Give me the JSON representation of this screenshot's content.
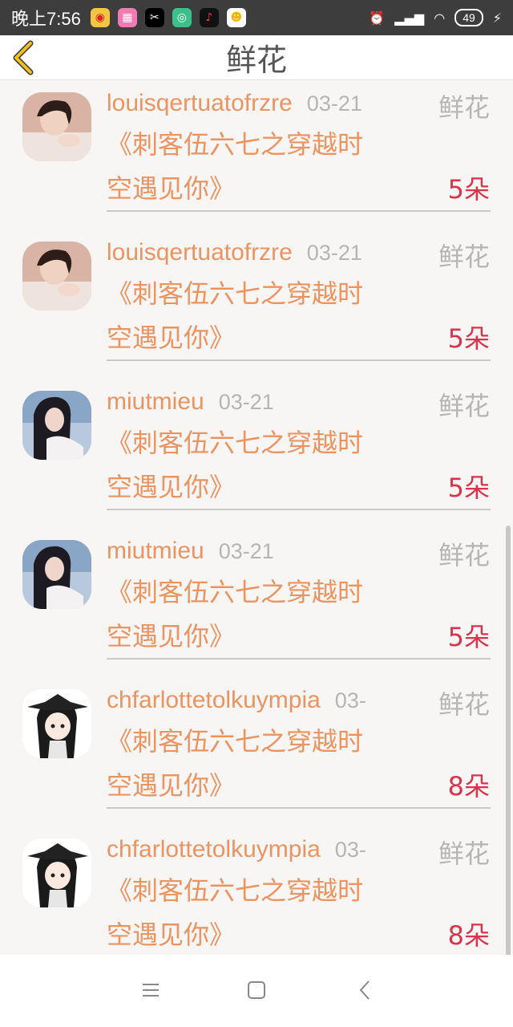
{
  "status": {
    "time": "晚上7:56",
    "battery": "49",
    "apps": [
      "weibo-icon",
      "game-icon",
      "capcut-icon",
      "signal-app-icon",
      "tiktok-icon",
      "chat-app-icon"
    ]
  },
  "header": {
    "title": "鲜花"
  },
  "items": [
    {
      "user": "louisqertuatofrzre",
      "date": "03-21",
      "gift": "鲜花",
      "work_line1": "《刺客伍六七之穿越时",
      "work_line2": "空遇见你》",
      "count": "5朵",
      "avatar": "girl-reading"
    },
    {
      "user": "louisqertuatofrzre",
      "date": "03-21",
      "gift": "鲜花",
      "work_line1": "《刺客伍六七之穿越时",
      "work_line2": "空遇见你》",
      "count": "5朵",
      "avatar": "girl-reading"
    },
    {
      "user": "miutmieu",
      "date": "03-21",
      "gift": "鲜花",
      "work_line1": "《刺客伍六七之穿越时",
      "work_line2": "空遇见你》",
      "count": "5朵",
      "avatar": "girl-sky"
    },
    {
      "user": "miutmieu",
      "date": "03-21",
      "gift": "鲜花",
      "work_line1": "《刺客伍六七之穿越时",
      "work_line2": "空遇见你》",
      "count": "5朵",
      "avatar": "girl-sky"
    },
    {
      "user": "chfarlottetolkuympia",
      "date": "03-",
      "gift": "鲜花",
      "work_line1": "《刺客伍六七之穿越时",
      "work_line2": "空遇见你》",
      "count": "8朵",
      "avatar": "cartoon"
    },
    {
      "user": "chfarlottetolkuympia",
      "date": "03-",
      "gift": "鲜花",
      "work_line1": "《刺客伍六七之穿越时",
      "work_line2": "空遇见你》",
      "count": "8朵",
      "avatar": "cartoon"
    }
  ],
  "colors": {
    "username": "#ec9460",
    "count": "#d8344b",
    "muted": "#b5b5b5",
    "back_arrow": "#f0c020"
  },
  "nav": [
    "menu-icon",
    "home-icon",
    "back-icon"
  ]
}
